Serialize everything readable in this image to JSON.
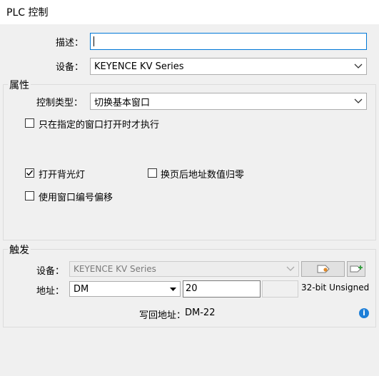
{
  "window": {
    "title": "PLC 控制"
  },
  "form": {
    "description_label": "描述：",
    "description_value": "",
    "device_label": "设备：",
    "device_value": "KEYENCE KV Series"
  },
  "properties": {
    "legend": "属性",
    "control_type_label": "控制类型：",
    "control_type_value": "切换基本窗口",
    "only_specified_window": {
      "label": "只在指定的窗口打开时才执行",
      "checked": false
    },
    "turn_on_backlight": {
      "label": "打开背光灯",
      "checked": true
    },
    "reset_address_on_page": {
      "label": "换页后地址数值归零",
      "checked": false
    },
    "use_window_offset": {
      "label": "使用窗口编号偏移",
      "checked": false
    }
  },
  "trigger": {
    "legend": "触发",
    "device_label": "设备：",
    "device_value": "KEYENCE KV Series",
    "address_label": "地址：",
    "address_type": "DM",
    "address_value": "20",
    "data_format": "32-bit Unsigned",
    "writeback_label": "写回地址：",
    "writeback_value": "DM-22",
    "info_glyph": "i"
  },
  "icons": {
    "tag_icon": "tag-settings-icon",
    "add_tag_icon": "add-tag-icon",
    "info_icon": "info-icon"
  },
  "colors": {
    "focus_border": "#0078d7",
    "check_mark": "#000000",
    "info_blue": "#1e7fd8"
  }
}
